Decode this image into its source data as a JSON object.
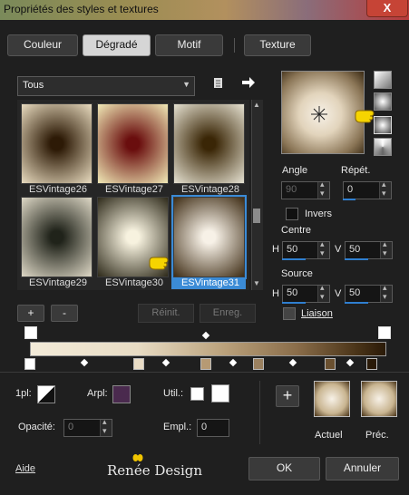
{
  "window": {
    "title": "Propriétés des styles et textures",
    "close": "X"
  },
  "tabs": [
    {
      "label": "Couleur",
      "active": false
    },
    {
      "label": "Dégradé",
      "active": true
    },
    {
      "label": "Motif",
      "active": false
    },
    {
      "label": "Texture",
      "active": false
    }
  ],
  "category": {
    "value": "Tous"
  },
  "gallery": {
    "items": [
      {
        "label": "ESVintage26",
        "inner": "#2d1a06",
        "outer": "#e9dcc0"
      },
      {
        "label": "ESVintage27",
        "inner": "#6a0e0e",
        "outer": "#f1eab7"
      },
      {
        "label": "ESVintage28",
        "inner": "#3a2606",
        "outer": "#e6e2d2"
      },
      {
        "label": "ESVintage29",
        "inner": "#20231a",
        "outer": "#ded8c6"
      },
      {
        "label": "ESVintage30",
        "inner": "#f7f2df",
        "outer": "#2e2a1a"
      },
      {
        "label": "ESVintage31",
        "inner": "#f7f1e7",
        "outer": "#3e2c14",
        "selected": true
      }
    ]
  },
  "buttons": {
    "add": "+",
    "remove": "-",
    "reset": "Réinit.",
    "save": "Enreg."
  },
  "angle": {
    "label": "Angle",
    "value": "90"
  },
  "repeat": {
    "label": "Répét.",
    "value": "0"
  },
  "invert": {
    "label": "Invers"
  },
  "center": {
    "label": "Centre",
    "h_label": "H",
    "h_value": "50",
    "v_label": "V",
    "v_value": "50"
  },
  "source": {
    "label": "Source",
    "h_label": "H",
    "h_value": "50",
    "v_label": "V",
    "v_value": "50"
  },
  "link": {
    "label": "Liaison"
  },
  "bottom": {
    "pl_label": "1pl:",
    "arpl_label": "Arpl:",
    "arpl_color": "#4a2a4e",
    "util_label": "Util.:",
    "opacity_label": "Opacité:",
    "opacity_value": "0",
    "empl_label": "Empl.:",
    "empl_value": "0",
    "current_label": "Actuel",
    "previous_label": "Préc."
  },
  "footer": {
    "help": "Aide",
    "ok": "OK",
    "cancel": "Annuler",
    "logo": "Renée Design"
  },
  "icons": {
    "pin": "pushpin-icon",
    "arrow": "arrow-right-icon",
    "cursor": "hand-pointer-icon",
    "center": "center-target-icon"
  }
}
